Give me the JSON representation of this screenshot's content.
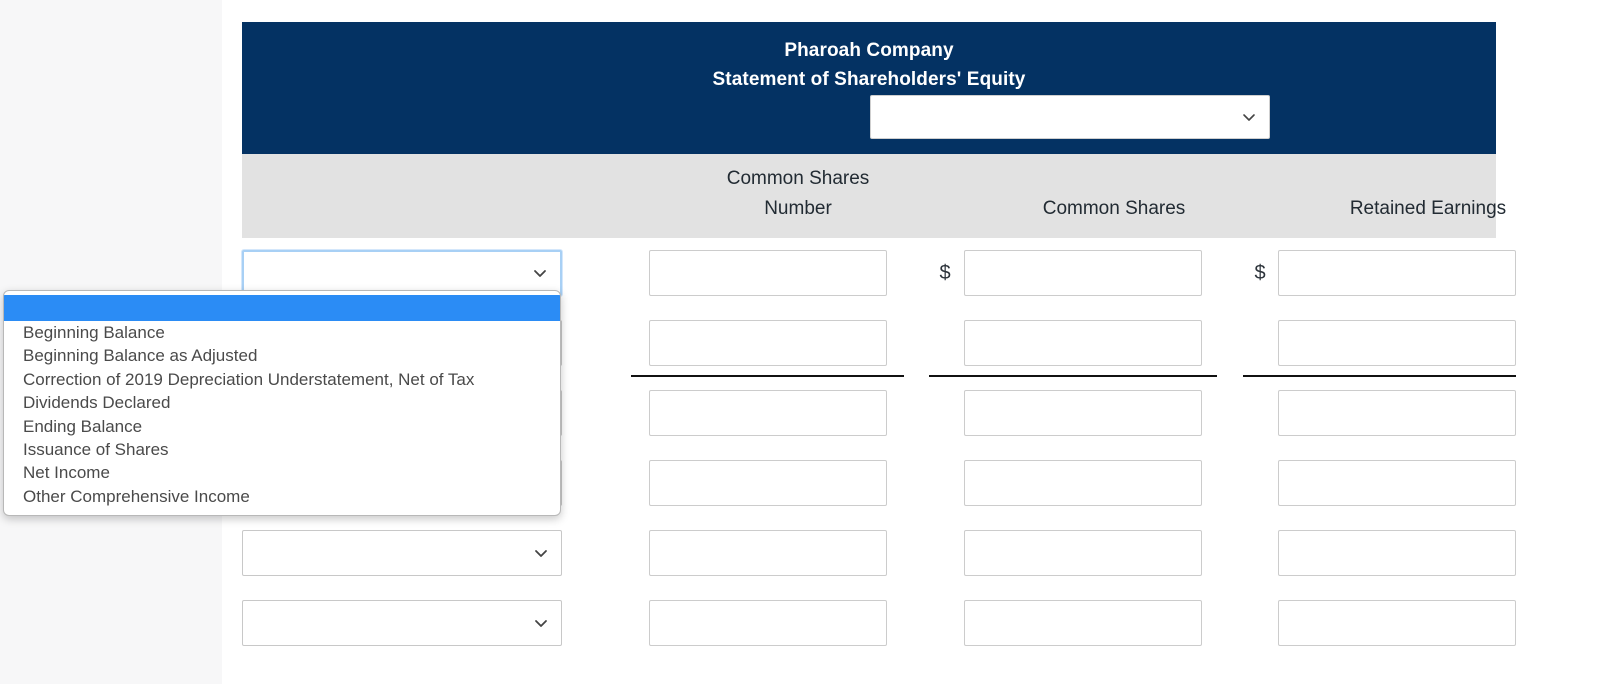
{
  "header": {
    "company": "Pharoah Company",
    "statement_title": "Statement of Shareholders' Equity",
    "period_select_value": "",
    "chevron_icon": "chevron-down-icon"
  },
  "columns": {
    "label_col": "",
    "shares_number_line1": "Common Shares",
    "shares_number_line2": "Number",
    "common_shares": "Common Shares",
    "retained_earnings": "Retained Earnings"
  },
  "currency_symbol": "$",
  "rows": [
    {
      "label_value": "",
      "focused": true,
      "show_dollar": true,
      "rule_below": false,
      "c1": "",
      "c2": "",
      "c3": ""
    },
    {
      "label_value": "",
      "focused": false,
      "show_dollar": false,
      "rule_below": true,
      "c1": "",
      "c2": "",
      "c3": ""
    },
    {
      "label_value": "",
      "focused": false,
      "show_dollar": false,
      "rule_below": false,
      "c1": "",
      "c2": "",
      "c3": ""
    },
    {
      "label_value": "",
      "focused": false,
      "show_dollar": false,
      "rule_below": false,
      "c1": "",
      "c2": "",
      "c3": ""
    },
    {
      "label_value": "",
      "focused": false,
      "show_dollar": false,
      "rule_below": false,
      "c1": "",
      "c2": "",
      "c3": ""
    },
    {
      "label_value": "",
      "focused": false,
      "show_dollar": false,
      "rule_below": false,
      "c1": "",
      "c2": "",
      "c3": ""
    }
  ],
  "dropdown": {
    "open": true,
    "highlighted_index": 0,
    "options": [
      "",
      "Beginning Balance",
      "Beginning Balance as Adjusted",
      "Correction of 2019 Depreciation Understatement, Net of Tax",
      "Dividends Declared",
      "Ending Balance",
      "Issuance of Shares",
      "Net Income",
      "Other Comprehensive Income"
    ]
  },
  "colors": {
    "title_band": "#043263",
    "column_header": "#e2e2e2",
    "highlight": "#2b8cf5",
    "page_background": "#f7f7f8",
    "content_background": "#ffffff"
  }
}
